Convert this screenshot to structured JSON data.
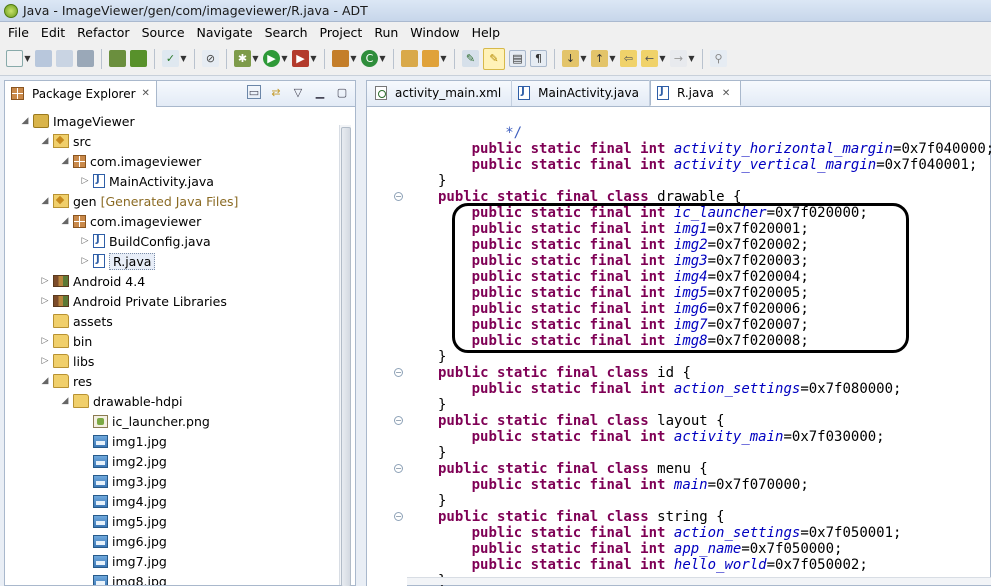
{
  "window": {
    "title": "Java - ImageViewer/gen/com/imageviewer/R.java - ADT"
  },
  "menu": {
    "items": [
      {
        "label": "File"
      },
      {
        "label": "Edit"
      },
      {
        "label": "Refactor"
      },
      {
        "label": "Source"
      },
      {
        "label": "Navigate"
      },
      {
        "label": "Search"
      },
      {
        "label": "Project"
      },
      {
        "label": "Run"
      },
      {
        "label": "Window"
      },
      {
        "label": "Help"
      }
    ]
  },
  "package_explorer": {
    "title": "Package Explorer",
    "tree": [
      {
        "label": "ImageViewer",
        "icon": "project-icon",
        "level": 0,
        "state": "open"
      },
      {
        "label": "src",
        "icon": "source-folder-icon",
        "level": 1,
        "state": "open"
      },
      {
        "label": "com.imageviewer",
        "icon": "package-icon",
        "level": 2,
        "state": "open"
      },
      {
        "label": "MainActivity.java",
        "icon": "java-file-icon",
        "level": 3,
        "state": "closed"
      },
      {
        "label": "gen",
        "decoration": "[Generated Java Files]",
        "icon": "source-folder-icon",
        "level": 1,
        "state": "open"
      },
      {
        "label": "com.imageviewer",
        "icon": "package-icon",
        "level": 2,
        "state": "open"
      },
      {
        "label": "BuildConfig.java",
        "icon": "java-file-icon",
        "level": 3,
        "state": "closed"
      },
      {
        "label": "R.java",
        "icon": "java-file-icon",
        "level": 3,
        "state": "closed",
        "selected": true
      },
      {
        "label": "Android 4.4",
        "icon": "library-icon",
        "level": 1,
        "state": "closed"
      },
      {
        "label": "Android Private Libraries",
        "icon": "library-icon",
        "level": 1,
        "state": "closed"
      },
      {
        "label": "assets",
        "icon": "folder-icon",
        "level": 1,
        "state": "none"
      },
      {
        "label": "bin",
        "icon": "folder-icon",
        "level": 1,
        "state": "closed"
      },
      {
        "label": "libs",
        "icon": "folder-icon",
        "level": 1,
        "state": "closed"
      },
      {
        "label": "res",
        "icon": "folder-icon",
        "level": 1,
        "state": "open"
      },
      {
        "label": "drawable-hdpi",
        "icon": "folder-icon",
        "level": 2,
        "state": "open"
      },
      {
        "label": "ic_launcher.png",
        "icon": "png-file-icon",
        "level": 3,
        "state": "none"
      },
      {
        "label": "img1.jpg",
        "icon": "image-file-icon",
        "level": 3,
        "state": "none"
      },
      {
        "label": "img2.jpg",
        "icon": "image-file-icon",
        "level": 3,
        "state": "none"
      },
      {
        "label": "img3.jpg",
        "icon": "image-file-icon",
        "level": 3,
        "state": "none"
      },
      {
        "label": "img4.jpg",
        "icon": "image-file-icon",
        "level": 3,
        "state": "none"
      },
      {
        "label": "img5.jpg",
        "icon": "image-file-icon",
        "level": 3,
        "state": "none"
      },
      {
        "label": "img6.jpg",
        "icon": "image-file-icon",
        "level": 3,
        "state": "none"
      },
      {
        "label": "img7.jpg",
        "icon": "image-file-icon",
        "level": 3,
        "state": "none"
      },
      {
        "label": "img8.jpg",
        "icon": "image-file-icon",
        "level": 3,
        "state": "none"
      }
    ]
  },
  "editor": {
    "tabs": [
      {
        "label": "activity_main.xml",
        "icon": "xml-file-icon",
        "active": false
      },
      {
        "label": "MainActivity.java",
        "icon": "java-file-icon",
        "active": false
      },
      {
        "label": "R.java",
        "icon": "java-file-icon",
        "active": true
      }
    ],
    "lines": [
      {
        "indent": 3,
        "parts": [
          [
            "cmt",
            "*/"
          ]
        ]
      },
      {
        "indent": 2,
        "parts": [
          [
            "kw",
            "public static final int "
          ],
          [
            "fld",
            "activity_horizontal_margin"
          ],
          [
            "num",
            "=0x7f040000;"
          ]
        ]
      },
      {
        "indent": 2,
        "parts": [
          [
            "kw",
            "public static final int "
          ],
          [
            "fld",
            "activity_vertical_margin"
          ],
          [
            "num",
            "=0x7f040001;"
          ]
        ]
      },
      {
        "indent": 1,
        "parts": [
          [
            "num",
            "}"
          ]
        ]
      },
      {
        "indent": 1,
        "fold": true,
        "parts": [
          [
            "kw",
            "public static final class "
          ],
          [
            "num",
            "drawable {"
          ]
        ]
      },
      {
        "indent": 2,
        "parts": [
          [
            "kw",
            "public static final int "
          ],
          [
            "fld",
            "ic_launcher"
          ],
          [
            "num",
            "=0x7f020000;"
          ]
        ]
      },
      {
        "indent": 2,
        "parts": [
          [
            "kw",
            "public static final int "
          ],
          [
            "fld",
            "img1"
          ],
          [
            "num",
            "=0x7f020001;"
          ]
        ]
      },
      {
        "indent": 2,
        "parts": [
          [
            "kw",
            "public static final int "
          ],
          [
            "fld",
            "img2"
          ],
          [
            "num",
            "=0x7f020002;"
          ]
        ]
      },
      {
        "indent": 2,
        "parts": [
          [
            "kw",
            "public static final int "
          ],
          [
            "fld",
            "img3"
          ],
          [
            "num",
            "=0x7f020003;"
          ]
        ]
      },
      {
        "indent": 2,
        "parts": [
          [
            "kw",
            "public static final int "
          ],
          [
            "fld",
            "img4"
          ],
          [
            "num",
            "=0x7f020004;"
          ]
        ]
      },
      {
        "indent": 2,
        "parts": [
          [
            "kw",
            "public static final int "
          ],
          [
            "fld",
            "img5"
          ],
          [
            "num",
            "=0x7f020005;"
          ]
        ]
      },
      {
        "indent": 2,
        "parts": [
          [
            "kw",
            "public static final int "
          ],
          [
            "fld",
            "img6"
          ],
          [
            "num",
            "=0x7f020006;"
          ]
        ]
      },
      {
        "indent": 2,
        "parts": [
          [
            "kw",
            "public static final int "
          ],
          [
            "fld",
            "img7"
          ],
          [
            "num",
            "=0x7f020007;"
          ]
        ]
      },
      {
        "indent": 2,
        "parts": [
          [
            "kw",
            "public static final int "
          ],
          [
            "fld",
            "img8"
          ],
          [
            "num",
            "=0x7f020008;"
          ]
        ]
      },
      {
        "indent": 1,
        "parts": [
          [
            "num",
            "}"
          ]
        ]
      },
      {
        "indent": 1,
        "fold": true,
        "parts": [
          [
            "kw",
            "public static final class "
          ],
          [
            "num",
            "id {"
          ]
        ]
      },
      {
        "indent": 2,
        "parts": [
          [
            "kw",
            "public static final int "
          ],
          [
            "fld",
            "action_settings"
          ],
          [
            "num",
            "=0x7f080000;"
          ]
        ]
      },
      {
        "indent": 1,
        "parts": [
          [
            "num",
            "}"
          ]
        ]
      },
      {
        "indent": 1,
        "fold": true,
        "parts": [
          [
            "kw",
            "public static final class "
          ],
          [
            "num",
            "layout {"
          ]
        ]
      },
      {
        "indent": 2,
        "parts": [
          [
            "kw",
            "public static final int "
          ],
          [
            "fld",
            "activity_main"
          ],
          [
            "num",
            "=0x7f030000;"
          ]
        ]
      },
      {
        "indent": 1,
        "parts": [
          [
            "num",
            "}"
          ]
        ]
      },
      {
        "indent": 1,
        "fold": true,
        "parts": [
          [
            "kw",
            "public static final class "
          ],
          [
            "num",
            "menu {"
          ]
        ]
      },
      {
        "indent": 2,
        "parts": [
          [
            "kw",
            "public static final int "
          ],
          [
            "fld",
            "main"
          ],
          [
            "num",
            "=0x7f070000;"
          ]
        ]
      },
      {
        "indent": 1,
        "parts": [
          [
            "num",
            "}"
          ]
        ]
      },
      {
        "indent": 1,
        "fold": true,
        "parts": [
          [
            "kw",
            "public static final class "
          ],
          [
            "num",
            "string {"
          ]
        ]
      },
      {
        "indent": 2,
        "parts": [
          [
            "kw",
            "public static final int "
          ],
          [
            "fld",
            "action_settings"
          ],
          [
            "num",
            "=0x7f050001;"
          ]
        ]
      },
      {
        "indent": 2,
        "parts": [
          [
            "kw",
            "public static final int "
          ],
          [
            "fld",
            "app_name"
          ],
          [
            "num",
            "=0x7f050000;"
          ]
        ]
      },
      {
        "indent": 2,
        "parts": [
          [
            "kw",
            "public static final int "
          ],
          [
            "fld",
            "hello_world"
          ],
          [
            "num",
            "=0x7f050002;"
          ]
        ]
      },
      {
        "indent": 1,
        "parts": [
          [
            "num",
            "}"
          ]
        ]
      }
    ]
  }
}
